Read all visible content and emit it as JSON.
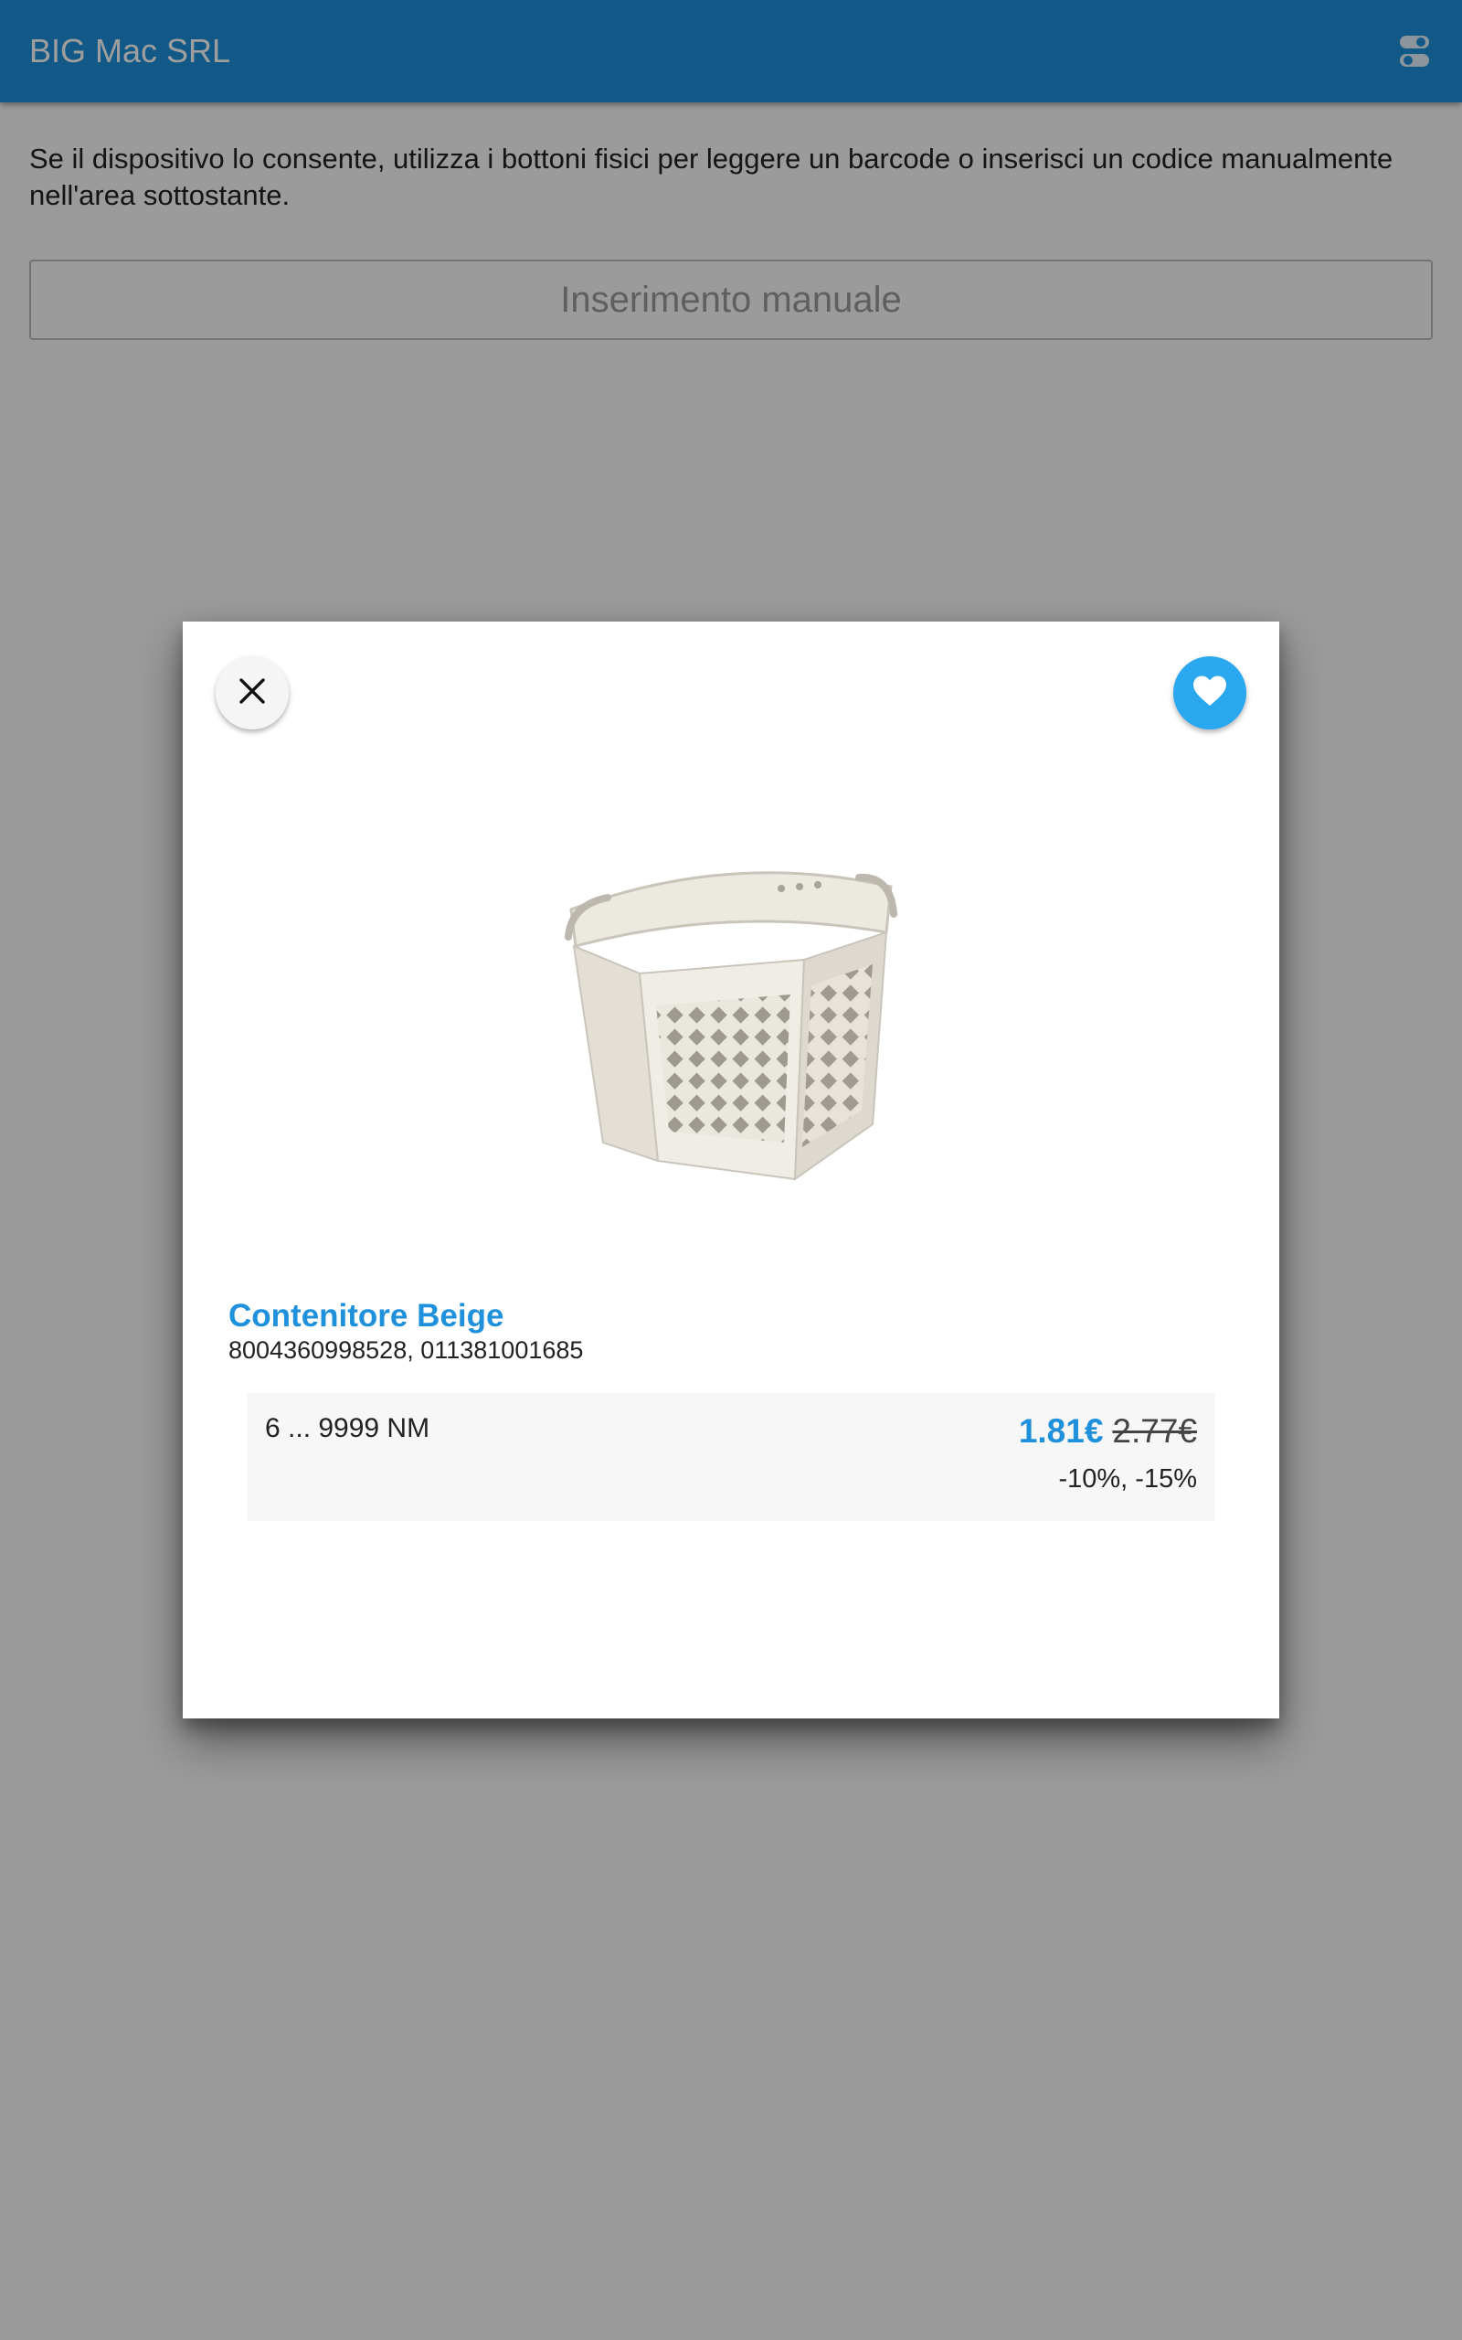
{
  "appbar": {
    "title": "BIG Mac SRL",
    "settings_icon": "settings-toggle-icon"
  },
  "main": {
    "instructions": "Se il dispositivo lo consente, utilizza i bottoni fisici per leggere un barcode o inserisci un codice manualmente nell'area sottostante.",
    "manual_input_placeholder": "Inserimento manuale",
    "manual_input_value": ""
  },
  "dialog": {
    "close_icon": "close-icon",
    "favorite_icon": "heart-icon",
    "product_image": "laundry-basket-image",
    "product": {
      "name": "Contenitore Beige",
      "codes": "8004360998528, 011381001685"
    },
    "price_row": {
      "quantity_range": "6 ... 9999 NM",
      "price_current": "1.81€",
      "price_original": "2.77€",
      "discounts": "-10%, -15%"
    }
  },
  "colors": {
    "primary": "#1e90dc",
    "favorite": "#29a8f0",
    "overlay": "rgba(0,0,0,0.38)"
  }
}
